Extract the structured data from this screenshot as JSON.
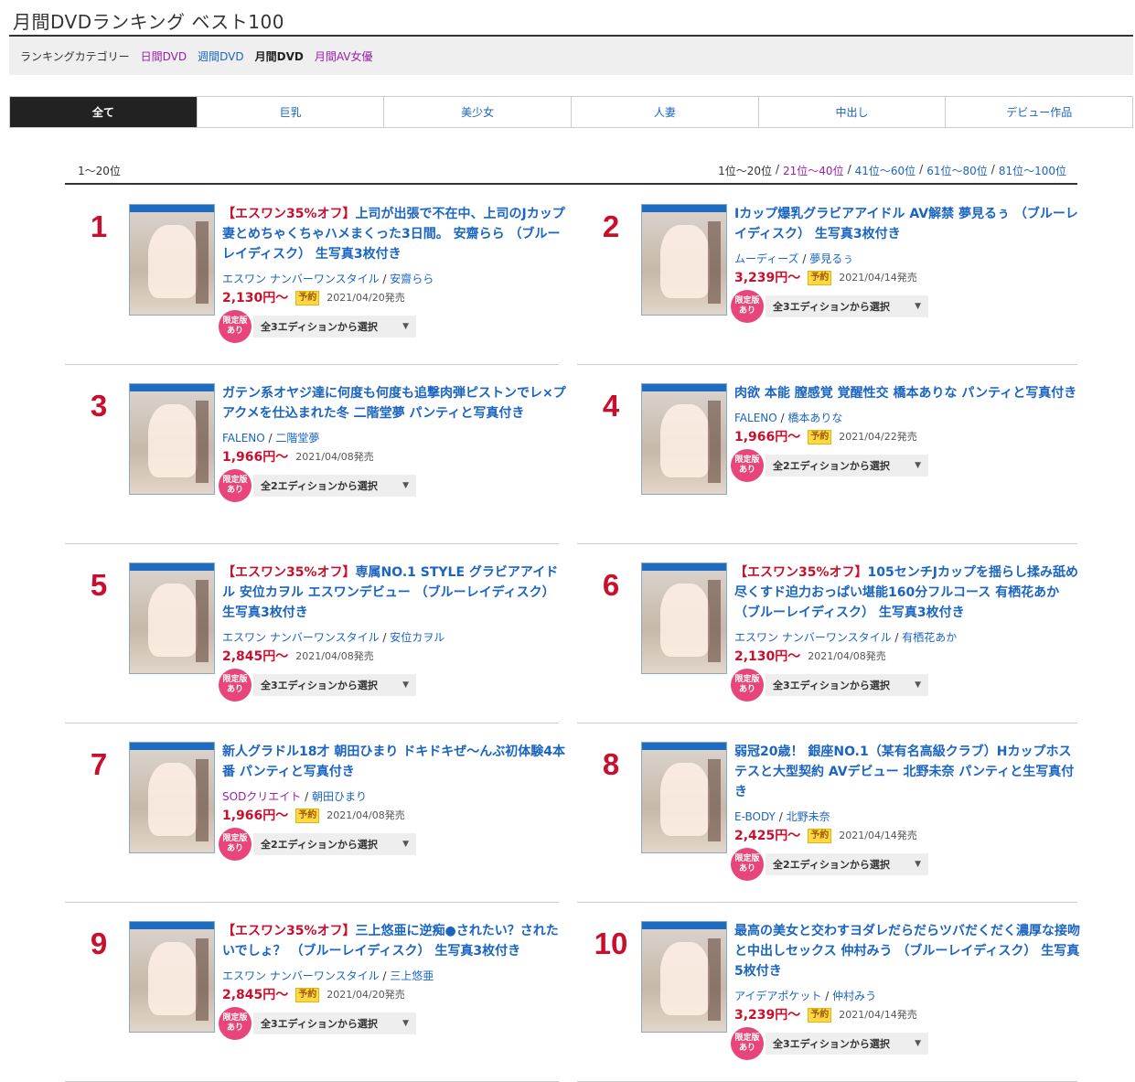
{
  "page_title": "月間DVDランキング ベスト100",
  "category": {
    "label": "ランキングカテゴリー",
    "links": [
      {
        "label": "日間DVD",
        "style": "purple"
      },
      {
        "label": "週間DVD",
        "style": "blue"
      },
      {
        "label": "月間DVD",
        "style": "current"
      },
      {
        "label": "月間AV女優",
        "style": "purple"
      }
    ]
  },
  "tabs": [
    "全て",
    "巨乳",
    "美少女",
    "人妻",
    "中出し",
    "デビュー作品"
  ],
  "range": {
    "current": "1〜20位",
    "pages": [
      "1位〜20位",
      "21位〜40位",
      "41位〜60位",
      "61位〜80位",
      "81位〜100位"
    ]
  },
  "common": {
    "yoyaku": "予約",
    "limited_1": "限定版",
    "limited_2": "あり",
    "slash": "/"
  },
  "items": [
    {
      "rank": "1",
      "promo": "【エスワン35%オフ】",
      "title": "上司が出張で不在中、上司のJカップ妻とめちゃくちゃハメまくった3日間。 安齋らら （ブルーレイディスク） 生写真3枚付き",
      "maker": "エスワン ナンバーワンスタイル",
      "maker_style": "blue",
      "actress": "安齋らら",
      "price": "2,130円〜",
      "yoyaku": true,
      "release": "2021/04/20発売",
      "edition": "全3エディションから選択"
    },
    {
      "rank": "2",
      "promo": "",
      "title": "Iカップ爆乳グラビアアイドル AV解禁 夢見るぅ （ブルーレイディスク） 生写真3枚付き",
      "maker": "ムーディーズ",
      "maker_style": "blue",
      "actress": "夢見るぅ",
      "price": "3,239円〜",
      "yoyaku": true,
      "release": "2021/04/14発売",
      "edition": "全3エディションから選択"
    },
    {
      "rank": "3",
      "promo": "",
      "title": "ガテン系オヤジ達に何度も何度も追撃肉弾ピストンでレ×プアクメを仕込まれた冬 二階堂夢 パンティと写真付き",
      "maker": "FALENO",
      "maker_style": "blue",
      "actress": "二階堂夢",
      "price": "1,966円〜",
      "yoyaku": false,
      "release": "2021/04/08発売",
      "edition": "全2エディションから選択"
    },
    {
      "rank": "4",
      "promo": "",
      "title": "肉欲 本能 膣感覚 覚醒性交 橋本ありな パンティと写真付き",
      "maker": "FALENO",
      "maker_style": "blue",
      "actress": "橋本ありな",
      "price": "1,966円〜",
      "yoyaku": true,
      "release": "2021/04/22発売",
      "edition": "全2エディションから選択"
    },
    {
      "rank": "5",
      "promo": "【エスワン35%オフ】",
      "title": "専属NO.1 STYLE グラビアアイドル 安位カヲル エスワンデビュー （ブルーレイディスク） 生写真3枚付き",
      "maker": "エスワン ナンバーワンスタイル",
      "maker_style": "blue",
      "actress": "安位カヲル",
      "price": "2,845円〜",
      "yoyaku": false,
      "release": "2021/04/08発売",
      "edition": "全3エディションから選択"
    },
    {
      "rank": "6",
      "promo": "【エスワン35%オフ】",
      "title": "105センチJカップを揺らし揉み舐め尽くすド迫力おっぱい堪能160分フルコース 有栖花あか （ブルーレイディスク） 生写真3枚付き",
      "maker": "エスワン ナンバーワンスタイル",
      "maker_style": "blue",
      "actress": "有栖花あか",
      "price": "2,130円〜",
      "yoyaku": false,
      "release": "2021/04/08発売",
      "edition": "全3エディションから選択"
    },
    {
      "rank": "7",
      "promo": "",
      "title": "新人グラドル18才 朝田ひまり ドキドキぜ〜んぶ初体験4本番 パンティと写真付き",
      "maker": "SODクリエイト",
      "maker_style": "purple",
      "actress": "朝田ひまり",
      "price": "1,966円〜",
      "yoyaku": true,
      "release": "2021/04/08発売",
      "edition": "全2エディションから選択"
    },
    {
      "rank": "8",
      "promo": "",
      "title": "弱冠20歳！ 銀座NO.1（某有名高級クラブ）Hカップホステスと大型契約 AVデビュー 北野未奈 パンティと生写真付き",
      "maker": "E-BODY",
      "maker_style": "blue",
      "actress": "北野未奈",
      "price": "2,425円〜",
      "yoyaku": true,
      "release": "2021/04/14発売",
      "edition": "全2エディションから選択"
    },
    {
      "rank": "9",
      "promo": "【エスワン35%オフ】",
      "title": "三上悠亜に逆痴●されたい？されたいでしょ？ （ブルーレイディスク） 生写真3枚付き",
      "maker": "エスワン ナンバーワンスタイル",
      "maker_style": "blue",
      "actress": "三上悠亜",
      "price": "2,845円〜",
      "yoyaku": true,
      "release": "2021/04/20発売",
      "edition": "全3エディションから選択"
    },
    {
      "rank": "10",
      "promo": "",
      "title": "最高の美女と交わすヨダレだらだらツバだくだく濃厚な接吻と中出しセックス 仲村みう （ブルーレイディスク） 生写真5枚付き",
      "maker": "アイデアポケット",
      "maker_style": "blue",
      "actress": "仲村みう",
      "price": "3,239円〜",
      "yoyaku": true,
      "release": "2021/04/14発売",
      "edition": "全3エディションから選択"
    }
  ]
}
